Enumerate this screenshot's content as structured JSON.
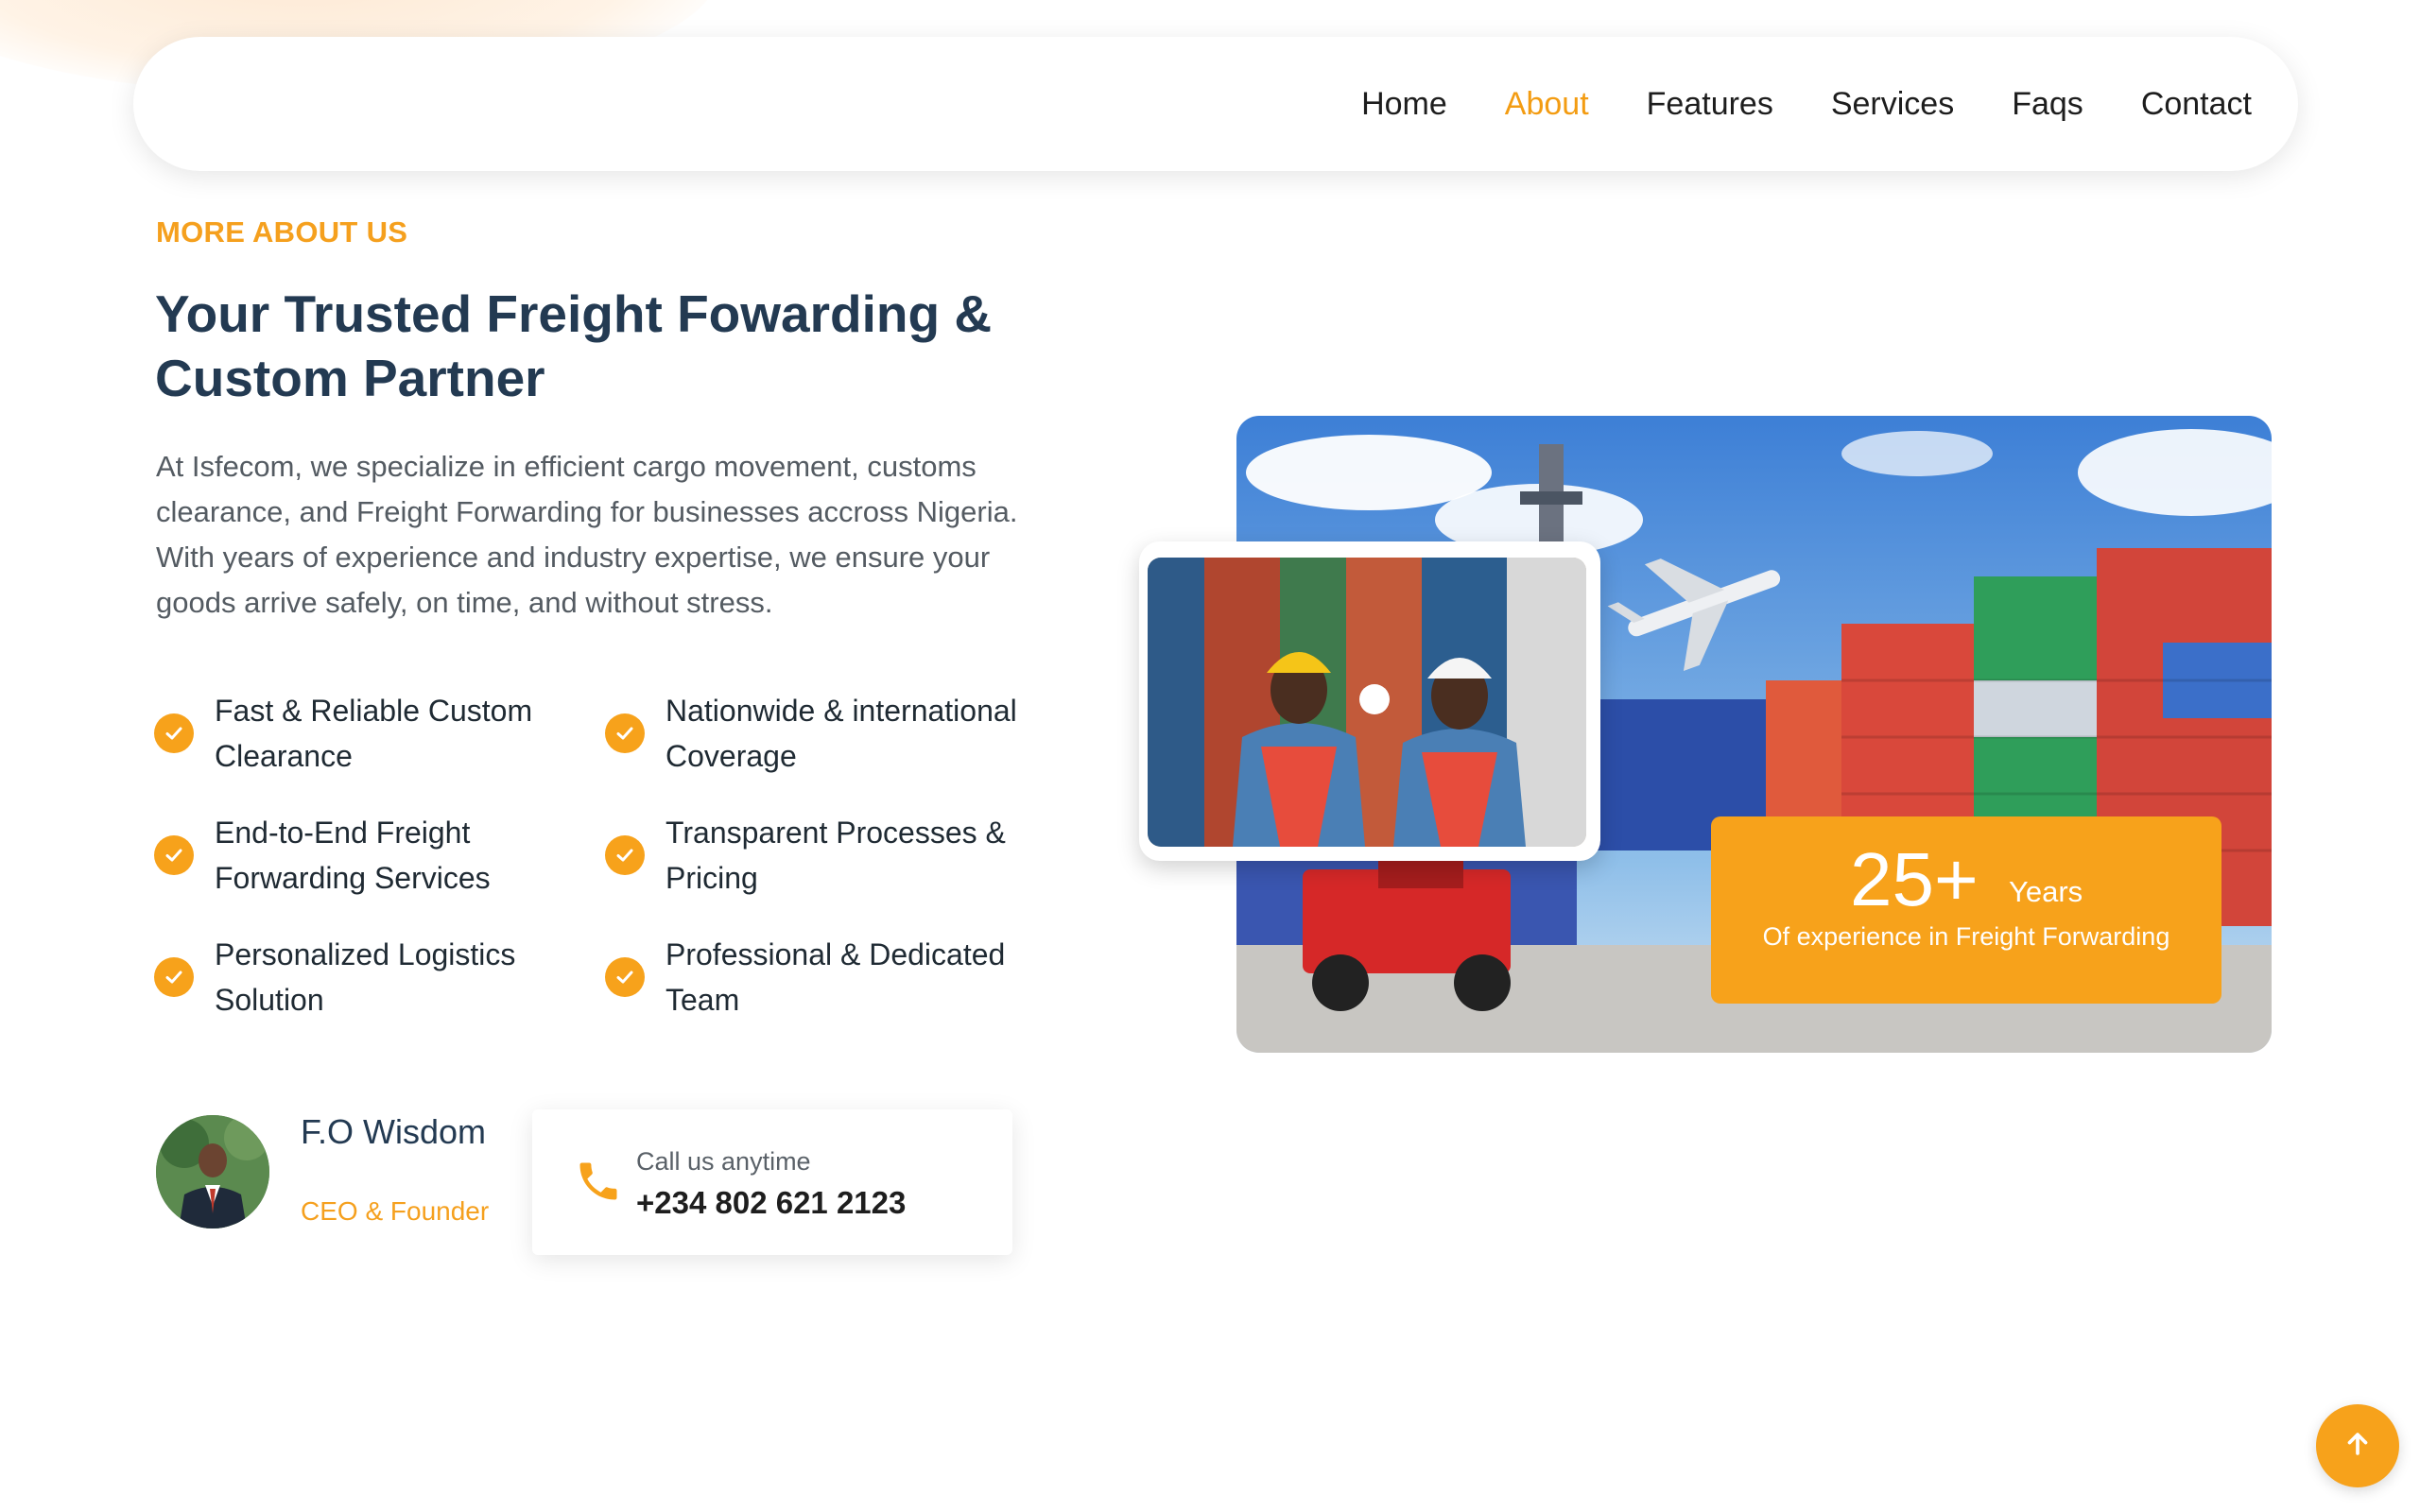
{
  "colors": {
    "accent": "#f7a21b",
    "heading": "#233a52",
    "body_text": "#545b62"
  },
  "nav": {
    "items": [
      {
        "label": "Home",
        "active": false
      },
      {
        "label": "About",
        "active": true
      },
      {
        "label": "Features",
        "active": false
      },
      {
        "label": "Services",
        "active": false
      },
      {
        "label": "Faqs",
        "active": false
      },
      {
        "label": "Contact",
        "active": false
      }
    ]
  },
  "about": {
    "eyebrow": "MORE ABOUT US",
    "headline": "Your Trusted Freight Fowarding & Custom Partner",
    "intro": "At Isfecom, we specialize in efficient cargo movement, customs clearance, and Freight Forwarding for businesses accross Nigeria. With years of experience and industry expertise, we ensure your goods arrive safely, on time, and without stress.",
    "features": [
      "Fast & Reliable Custom Clearance",
      "Nationwide & international Coverage",
      "End-to-End Freight Forwarding Services",
      "Transparent Processes & Pricing",
      "Personalized Logistics Solution",
      "Professional & Dedicated Team"
    ],
    "check_icon": "check-circle-icon"
  },
  "founder": {
    "name": "F.O Wisdom",
    "role": "CEO & Founder"
  },
  "call": {
    "label": "Call us anytime",
    "number": "+234 802 621 2123",
    "icon": "phone-icon"
  },
  "experience": {
    "number": "25+",
    "unit": "Years",
    "caption": "Of experience in Freight Forwarding"
  },
  "scroll_top": {
    "icon": "arrow-up-icon"
  }
}
